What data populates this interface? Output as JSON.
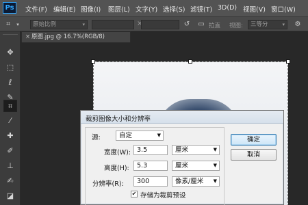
{
  "app": {
    "logo": "Ps"
  },
  "menu": [
    {
      "label": "文件(F)"
    },
    {
      "label": "编辑(E)"
    },
    {
      "label": "图像(I)"
    },
    {
      "label": "图层(L)"
    },
    {
      "label": "文字(Y)"
    },
    {
      "label": "选择(S)"
    },
    {
      "label": "滤镜(T)"
    },
    {
      "label": "3D(D)"
    },
    {
      "label": "视图(V)"
    },
    {
      "label": "窗口(W)"
    }
  ],
  "options_bar": {
    "ratio_label": "原始比例",
    "swap_symbol": "×",
    "straighten_label": "拉直",
    "view_label": "视图:",
    "view_value": "三等分"
  },
  "document": {
    "tab_close": "×",
    "tab_title": "原图.jpg @ 16.7%(RGB/8)"
  },
  "dialog": {
    "title": "裁剪图像大小和分辨率",
    "source_label": "源:",
    "source_value": "自定",
    "width_label": "宽度(W):",
    "width_value": "3.5",
    "width_unit": "厘米",
    "height_label": "高度(H):",
    "height_value": "5.3",
    "height_unit": "厘米",
    "resolution_label": "分辨率(R):",
    "resolution_value": "300",
    "resolution_unit": "像素/厘米",
    "save_preset_label": "存储为裁剪预设",
    "save_preset_checked": true,
    "ok_button": "确定",
    "cancel_button": "取消"
  },
  "colors": {
    "menubar": "#535353",
    "workspace": "#282828",
    "dialog_bg": "#f0f0f0",
    "ps_accent": "#31a8ff"
  },
  "tools": [
    "move-tool",
    "marquee-tool",
    "lasso-tool",
    "quick-select-tool",
    "crop-tool",
    "eyedropper-tool",
    "healing-brush-tool",
    "brush-tool",
    "clone-stamp-tool",
    "history-brush-tool",
    "eraser-tool",
    "gradient-tool"
  ]
}
